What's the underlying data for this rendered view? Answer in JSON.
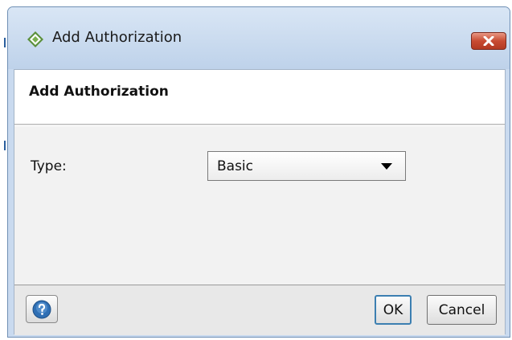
{
  "window": {
    "title": "Add Authorization",
    "icon": "app-diamond-icon",
    "close_icon": "close-icon"
  },
  "dialog": {
    "header_title": "Add Authorization"
  },
  "form": {
    "type_label": "Type:",
    "type_value": "Basic"
  },
  "footer": {
    "help_icon": "help-icon",
    "ok_label": "OK",
    "cancel_label": "Cancel"
  },
  "colors": {
    "titlebar": "#c9daef",
    "close_button": "#c84b32",
    "ok_focus_border": "#3c7fb1"
  }
}
